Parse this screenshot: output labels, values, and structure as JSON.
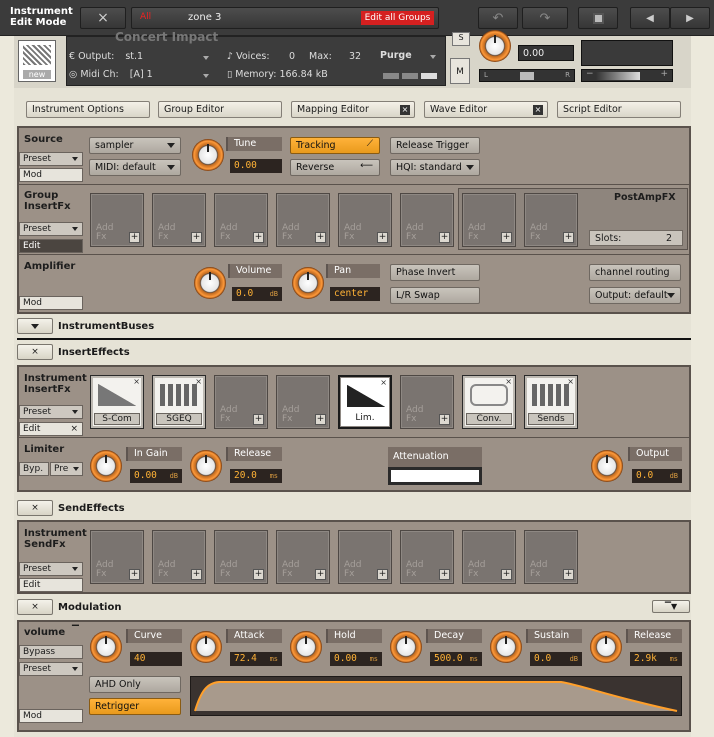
{
  "header": {
    "mode_line1": "Instrument",
    "mode_line2": "Edit Mode",
    "close_label": "×",
    "zone_name": "zone 3",
    "zone_tag": "All",
    "edit_all_groups": "Edit all Groups"
  },
  "instrument_header": {
    "title": "Concert Impact",
    "new_label": "new",
    "output_label": "Output:",
    "output_value": "st.1",
    "midi_label": "Midi Ch:",
    "midi_value": "[A] 1",
    "voices_label": "Voices:",
    "voices_value": "0",
    "max_label": "Max:",
    "max_value": "32",
    "memory_label": "Memory:",
    "memory_value": "166.84 kB",
    "purge_label": "Purge",
    "tune_value": "0.00",
    "m_label": "M",
    "s_label": "S",
    "l_label": "L",
    "r_label": "R"
  },
  "tabs": [
    {
      "label": "Instrument Options"
    },
    {
      "label": "Group Editor"
    },
    {
      "label": "Mapping Editor"
    },
    {
      "label": "Wave Editor"
    },
    {
      "label": "Script Editor"
    }
  ],
  "source": {
    "title": "Source",
    "preset": "Preset",
    "mod": "Mod",
    "engine": "sampler",
    "midi": "MIDI: default",
    "tune_label": "Tune",
    "tune_value": "0.00",
    "tracking": "Tracking",
    "reverse": "Reverse",
    "release_trigger": "Release Trigger",
    "hqi": "HQI: standard"
  },
  "group_insert": {
    "title_line1": "Group",
    "title_line2": "InsertFx",
    "preset": "Preset",
    "edit": "Edit",
    "slot_label_1": "Add",
    "slot_label_2": "Fx",
    "post_amp": "PostAmpFX",
    "slots_label": "Slots:",
    "slots_value": "2"
  },
  "amplifier": {
    "title": "Amplifier",
    "mod": "Mod",
    "volume_label": "Volume",
    "volume_value": "0.0",
    "volume_unit": "dB",
    "pan_label": "Pan",
    "pan_value": "center",
    "phase_invert": "Phase Invert",
    "lr_swap": "L/R Swap",
    "channel_routing": "channel routing",
    "output": "Output: default"
  },
  "instrument_buses": {
    "label": "InstrumentBuses"
  },
  "insert_effects": {
    "label": "InsertEffects",
    "title_line1": "Instrument",
    "title_line2": "InsertFx",
    "preset": "Preset",
    "edit": "Edit",
    "slots": [
      {
        "name": "S-Com",
        "type": "fx"
      },
      {
        "name": "SGEQ",
        "type": "fx"
      },
      {
        "name": "",
        "type": "empty"
      },
      {
        "name": "",
        "type": "empty"
      },
      {
        "name": "Lim.",
        "type": "selected"
      },
      {
        "name": "",
        "type": "empty"
      },
      {
        "name": "Conv.",
        "type": "fx"
      },
      {
        "name": "Sends",
        "type": "fx"
      }
    ]
  },
  "limiter": {
    "title": "Limiter",
    "byp": "Byp.",
    "pre": "Pre",
    "in_gain_label": "In Gain",
    "in_gain_value": "0.00",
    "in_gain_unit": "dB",
    "release_label": "Release",
    "release_value": "20.0",
    "release_unit": "ms",
    "attenuation_label": "Attenuation",
    "output_label": "Output",
    "output_value": "0.0",
    "output_unit": "dB"
  },
  "send_effects": {
    "label": "SendEffects",
    "title_line1": "Instrument",
    "title_line2": "SendFx",
    "preset": "Preset",
    "edit": "Edit"
  },
  "modulation": {
    "label": "Modulation",
    "target": "volume",
    "bypass": "Bypass",
    "preset": "Preset",
    "mod": "Mod",
    "ahd_only": "AHD Only",
    "retrigger": "Retrigger",
    "knobs": [
      {
        "label": "Curve",
        "value": "40",
        "unit": ""
      },
      {
        "label": "Attack",
        "value": "72.4",
        "unit": "ms"
      },
      {
        "label": "Hold",
        "value": "0.00",
        "unit": "ms"
      },
      {
        "label": "Decay",
        "value": "500.0",
        "unit": "ms"
      },
      {
        "label": "Sustain",
        "value": "0.0",
        "unit": "dB"
      },
      {
        "label": "Release",
        "value": "2.9k",
        "unit": "ms"
      }
    ]
  }
}
